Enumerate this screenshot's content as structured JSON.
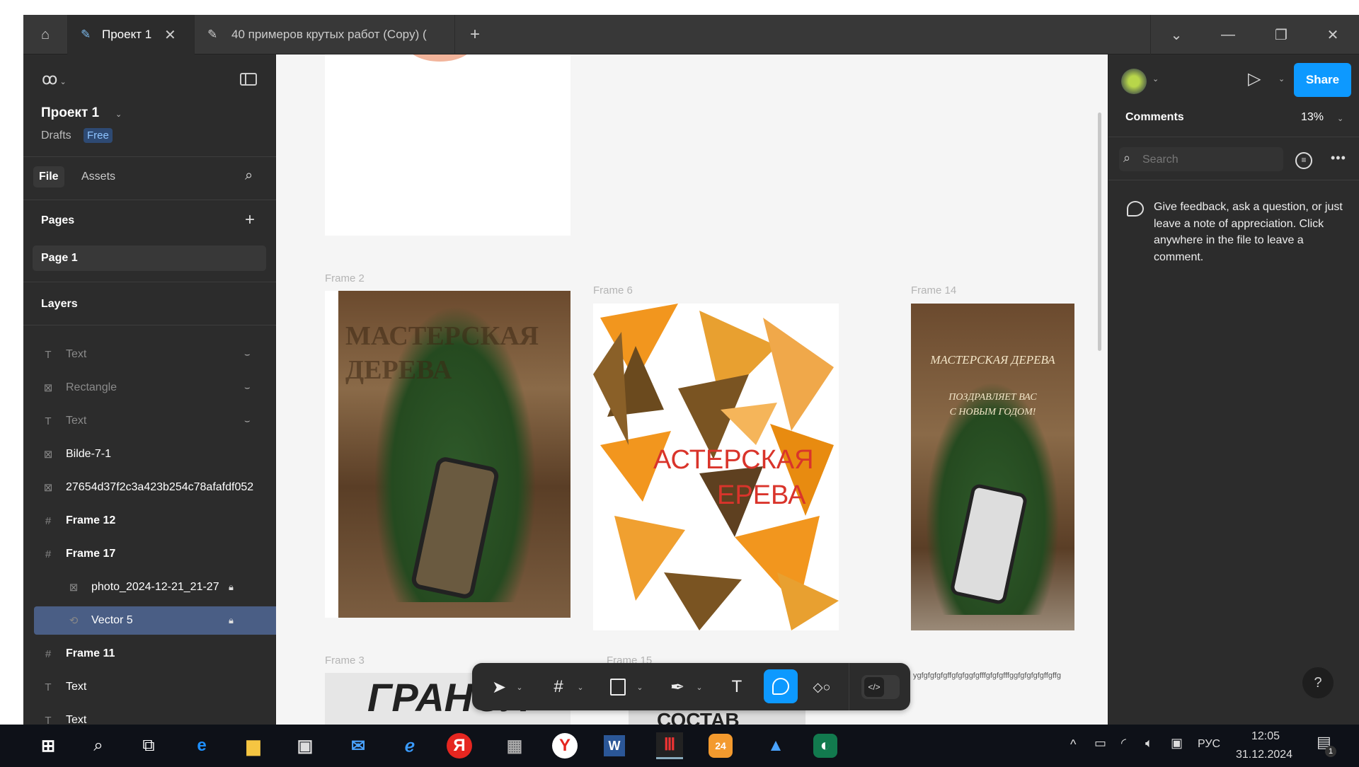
{
  "tabs": [
    {
      "label": "Проект 1"
    },
    {
      "label": "40 примеров крутых работ (Copy) ("
    }
  ],
  "left": {
    "project": "Проект 1",
    "drafts": "Drafts",
    "plan": "Free",
    "file_tab": "File",
    "assets_tab": "Assets",
    "pages_title": "Pages",
    "page": "Page 1",
    "layers_title": "Layers",
    "layers": [
      {
        "name": "Text",
        "icon": "text-icon",
        "hidden": true
      },
      {
        "name": "Rectangle",
        "icon": "image-icon",
        "hidden": true
      },
      {
        "name": "Text",
        "icon": "text-icon",
        "hidden": true
      },
      {
        "name": "Bilde-7-1",
        "icon": "image-icon"
      },
      {
        "name": "27654d37f2c3a423b254c78afafdf052",
        "icon": "image-icon"
      },
      {
        "name": "Frame 12",
        "icon": "frame-icon"
      },
      {
        "name": "Frame 17",
        "icon": "frame-icon"
      },
      {
        "name": "photo_2024-12-21_21-27",
        "icon": "image-icon",
        "locked": true,
        "child": true
      },
      {
        "name": "Vector 5",
        "icon": "vector-icon",
        "locked": true,
        "child": true,
        "selected": true
      },
      {
        "name": "Frame 11",
        "icon": "frame-icon"
      },
      {
        "name": "Text",
        "icon": "text-icon"
      },
      {
        "name": "Text",
        "icon": "text-icon"
      }
    ]
  },
  "canvas": {
    "frames": {
      "f2": "Frame 2",
      "f6": "Frame 6",
      "f14": "Frame 14",
      "f3": "Frame 3",
      "f15": "Frame 15"
    },
    "f2_text": "МАСТЕРСКАЯ ДЕРЕВА",
    "f6_line1": "АСТЕРСКАЯ",
    "f6_line2": "ЕРЕВА",
    "f14_title": "МАСТЕРСКАЯ ДЕРЕВА",
    "f14_greet1": "ПОЗДРАВЛЯЕТ ВАС",
    "f14_greet2": "С НОВЫМ ГОДОМ!",
    "f3_text": "ГРАНОЛ",
    "f3_text2": "СОСТАВ",
    "stray_text": "ygfgfgfgfgffgfgfggfgfffgfgfgfffggfgfgfgfgffgffg"
  },
  "right": {
    "share": "Share",
    "comments": "Comments",
    "zoom": "13%",
    "search_placeholder": "Search",
    "hint": "Give feedback, ask a question, or just leave a note of appreciation. Click anywhere in the file to leave a comment."
  },
  "taskbar": {
    "lang": "РУС",
    "time": "12:05",
    "date": "31.12.2024",
    "notifications": "1"
  },
  "colors": {
    "accent": "#0d99ff",
    "selected_layer": "#4a5e85",
    "canvas": "#f5f5f5",
    "panel": "#2c2c2c"
  }
}
